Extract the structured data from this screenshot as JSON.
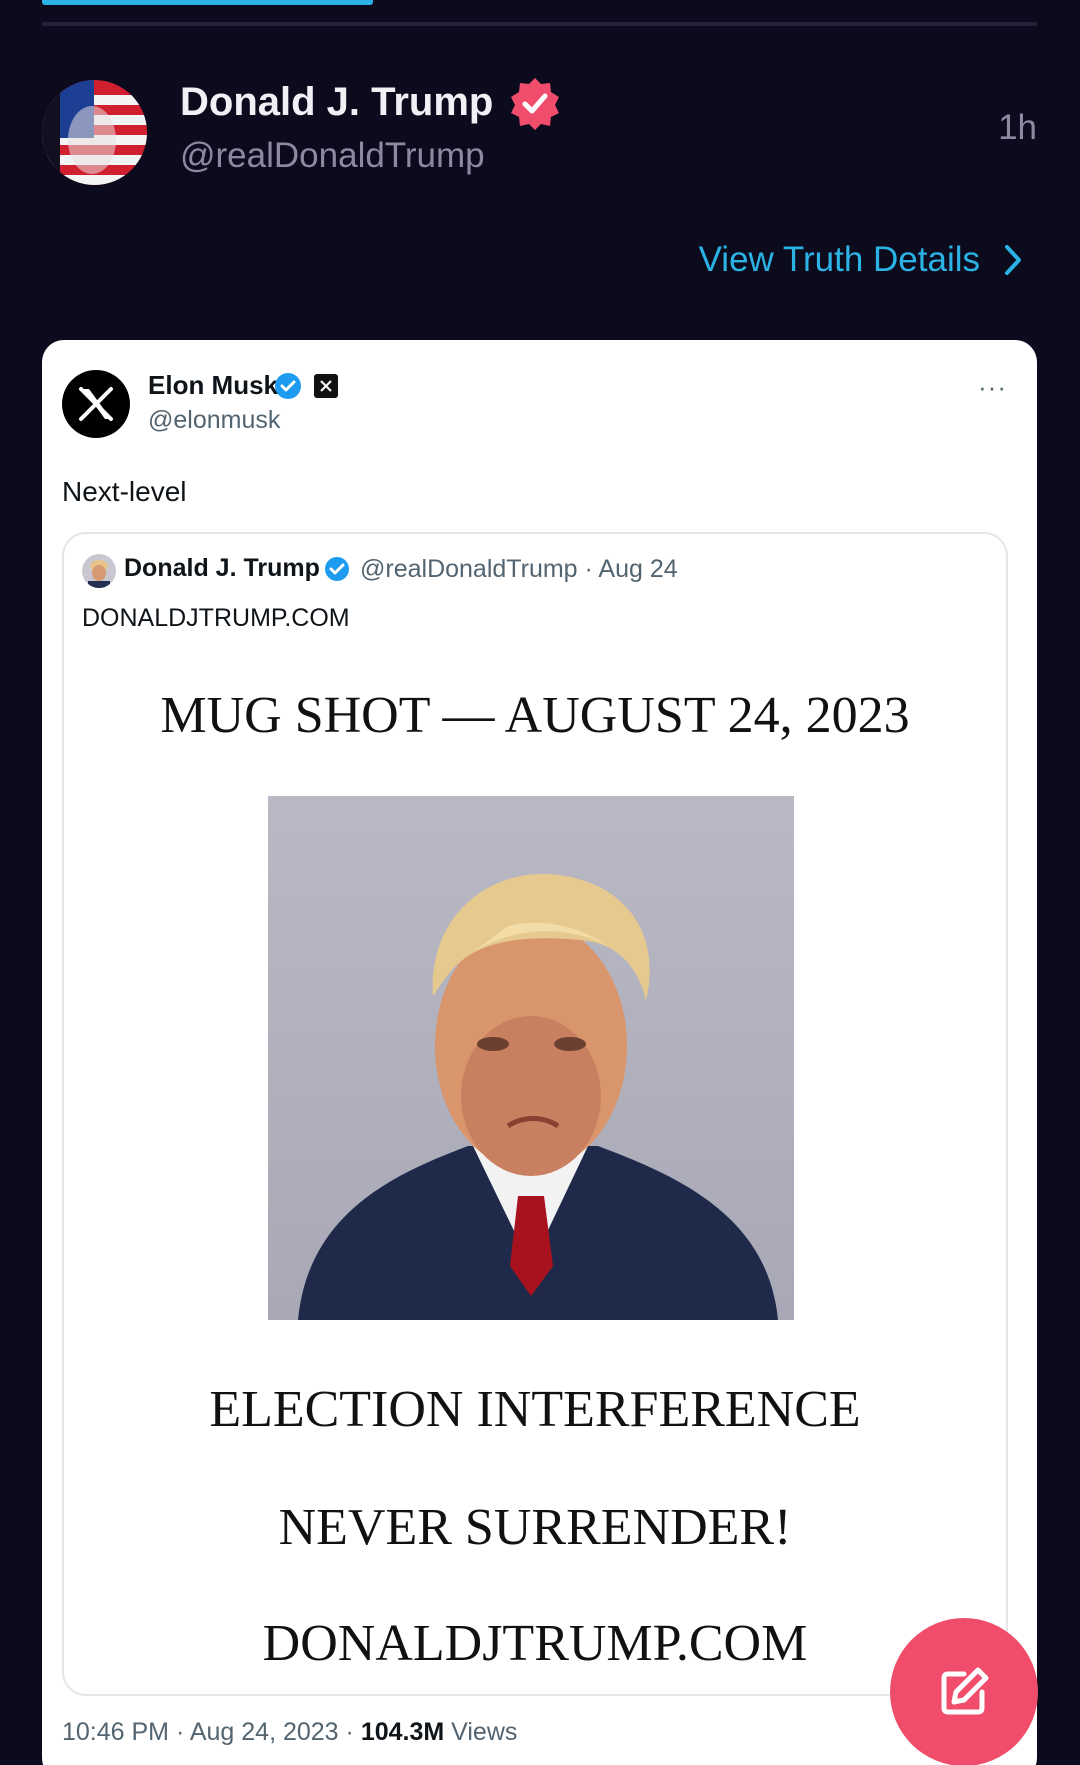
{
  "post": {
    "author_name": "Donald J. Trump",
    "author_handle": "@realDonaldTrump",
    "time": "1h",
    "view_details_label": "View Truth Details"
  },
  "embedded_tweet": {
    "author_name": "Elon Musk",
    "author_handle": "@elonmusk",
    "text": "Next-level",
    "more_label": "···",
    "quoted": {
      "author_name": "Donald J. Trump",
      "meta": "@realDonaldTrump · Aug 24",
      "site": "DONALDJTRUMP.COM",
      "graphic_title": "MUG SHOT — AUGUST 24, 2023",
      "line1": "ELECTION INTERFERENCE",
      "line2": "NEVER SURRENDER!",
      "line3": "DONALDJTRUMP.COM"
    },
    "footer_time": "10:46 PM · Aug 24, 2023 · ",
    "views_count": "104.3M",
    "views_label": " Views"
  },
  "colors": {
    "background": "#0c0a1d",
    "accent_blue": "#2bb3e6",
    "verified_badge": "#f04d6c",
    "compose_button": "#f04d6c"
  },
  "icons": {
    "verified": "verified-badge-icon",
    "chevron": "chevron-right-icon",
    "compose": "compose-icon",
    "x_logo": "x-logo-icon"
  }
}
